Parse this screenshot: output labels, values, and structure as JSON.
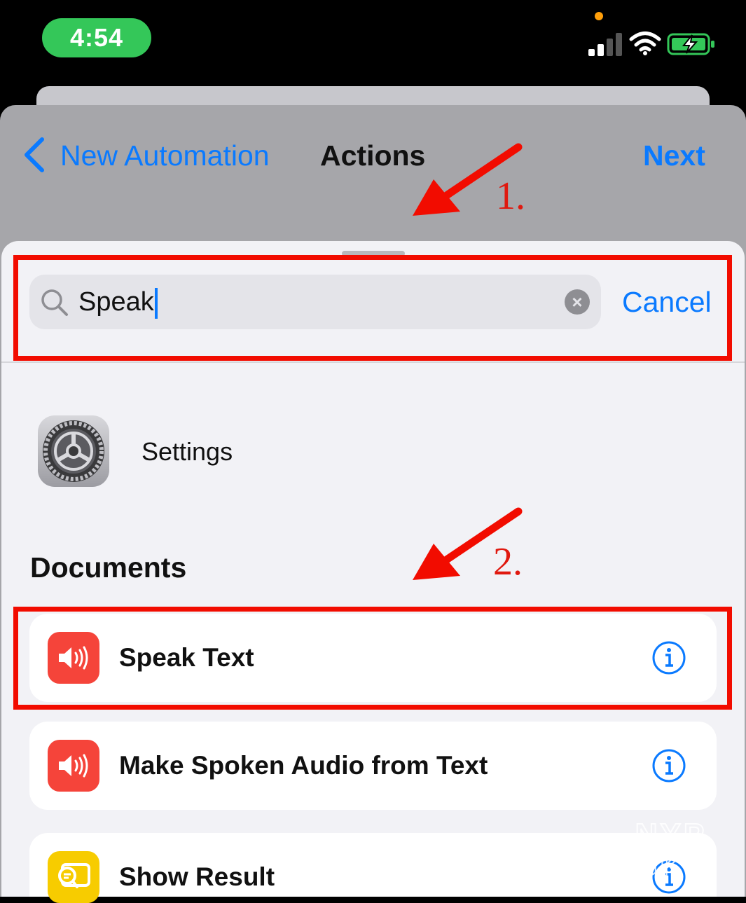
{
  "status_bar": {
    "time": "4:54"
  },
  "nav": {
    "back_label": "New Automation",
    "title": "Actions",
    "next_label": "Next"
  },
  "search": {
    "value": "Speak",
    "cancel_label": "Cancel"
  },
  "results": {
    "app": {
      "label": "Settings",
      "icon": "settings-gear-icon"
    },
    "section_header": "Documents",
    "actions": [
      {
        "label": "Speak Text",
        "icon": "speaker-icon",
        "icon_color": "#f5443a"
      },
      {
        "label": "Make Spoken Audio from Text",
        "icon": "speaker-icon",
        "icon_color": "#f5443a"
      },
      {
        "label": "Show Result",
        "icon": "show-result-icon",
        "icon_color": "#f7cc00"
      }
    ]
  },
  "annotations": {
    "step1": "1.",
    "step2": "2."
  },
  "watermark": {
    "line1": "NYP",
    "line2": "GKS"
  },
  "colors": {
    "accent": "#0a7aff",
    "annotation": "#f20c00",
    "time_pill": "#34c759"
  }
}
